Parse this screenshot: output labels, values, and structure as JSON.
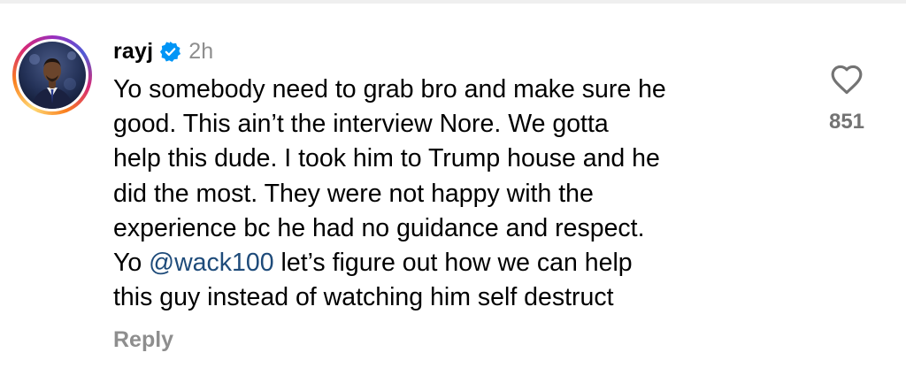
{
  "comment": {
    "username": "rayj",
    "timestamp": "2h",
    "verified": true,
    "lines": [
      {
        "before": "Yo somebody need to grab bro and make sure he"
      },
      {
        "before": "good. This ain’t the interview Nore. We gotta"
      },
      {
        "before": "help this dude. I took him to Trump house and he"
      },
      {
        "before": "did the most. They were not happy with the"
      },
      {
        "before": "experience bc he had no guidance and respect."
      },
      {
        "before": "Yo ",
        "mention": "@wack100",
        "after": " let’s figure out how we can help"
      },
      {
        "before": "this guy instead of watching him self destruct"
      }
    ],
    "reply_label": "Reply",
    "like_count": "851",
    "icons": {
      "verified": "verified-badge-icon",
      "like": "heart-outline-icon"
    }
  },
  "colors": {
    "verified_blue": "#0095f6",
    "mention": "#1e4b7a",
    "secondary_text": "#8e8e8e",
    "like_count": "#737373"
  }
}
